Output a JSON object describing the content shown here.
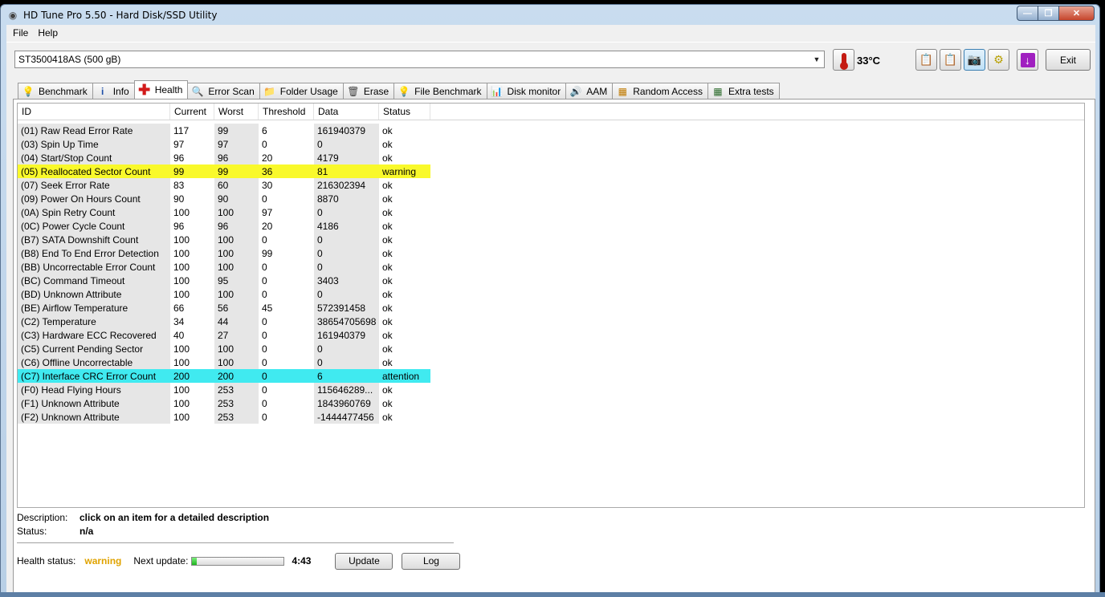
{
  "window": {
    "title": "HD Tune Pro 5.50 - Hard Disk/SSD Utility"
  },
  "menu": {
    "file": "File",
    "help": "Help"
  },
  "toolbar": {
    "drive": "ST3500418AS (500 gB)",
    "temperature": "33°C",
    "exit_label": "Exit"
  },
  "tabs": {
    "benchmark": "Benchmark",
    "info": "Info",
    "health": "Health",
    "error_scan": "Error Scan",
    "folder_usage": "Folder Usage",
    "erase": "Erase",
    "file_benchmark": "File Benchmark",
    "disk_monitor": "Disk monitor",
    "aam": "AAM",
    "random_access": "Random Access",
    "extra_tests": "Extra tests"
  },
  "grid": {
    "headers": [
      "ID",
      "Current",
      "Worst",
      "Threshold",
      "Data",
      "Status"
    ],
    "rows": [
      {
        "id": "(01) Raw Read Error Rate",
        "current": "117",
        "worst": "99",
        "threshold": "6",
        "data": "161940379",
        "status": "ok"
      },
      {
        "id": "(03) Spin Up Time",
        "current": "97",
        "worst": "97",
        "threshold": "0",
        "data": "0",
        "status": "ok"
      },
      {
        "id": "(04) Start/Stop Count",
        "current": "96",
        "worst": "96",
        "threshold": "20",
        "data": "4179",
        "status": "ok"
      },
      {
        "id": "(05) Reallocated Sector Count",
        "current": "99",
        "worst": "99",
        "threshold": "36",
        "data": "81",
        "status": "warning"
      },
      {
        "id": "(07) Seek Error Rate",
        "current": "83",
        "worst": "60",
        "threshold": "30",
        "data": "216302394",
        "status": "ok"
      },
      {
        "id": "(09) Power On Hours Count",
        "current": "90",
        "worst": "90",
        "threshold": "0",
        "data": "8870",
        "status": "ok"
      },
      {
        "id": "(0A) Spin Retry Count",
        "current": "100",
        "worst": "100",
        "threshold": "97",
        "data": "0",
        "status": "ok"
      },
      {
        "id": "(0C) Power Cycle Count",
        "current": "96",
        "worst": "96",
        "threshold": "20",
        "data": "4186",
        "status": "ok"
      },
      {
        "id": "(B7) SATA Downshift Count",
        "current": "100",
        "worst": "100",
        "threshold": "0",
        "data": "0",
        "status": "ok"
      },
      {
        "id": "(B8) End To End Error Detection",
        "current": "100",
        "worst": "100",
        "threshold": "99",
        "data": "0",
        "status": "ok"
      },
      {
        "id": "(BB) Uncorrectable Error Count",
        "current": "100",
        "worst": "100",
        "threshold": "0",
        "data": "0",
        "status": "ok"
      },
      {
        "id": "(BC) Command Timeout",
        "current": "100",
        "worst": "95",
        "threshold": "0",
        "data": "3403",
        "status": "ok"
      },
      {
        "id": "(BD) Unknown Attribute",
        "current": "100",
        "worst": "100",
        "threshold": "0",
        "data": "0",
        "status": "ok"
      },
      {
        "id": "(BE) Airflow Temperature",
        "current": "66",
        "worst": "56",
        "threshold": "45",
        "data": "572391458",
        "status": "ok"
      },
      {
        "id": "(C2) Temperature",
        "current": "34",
        "worst": "44",
        "threshold": "0",
        "data": "38654705698",
        "status": "ok"
      },
      {
        "id": "(C3) Hardware ECC Recovered",
        "current": "40",
        "worst": "27",
        "threshold": "0",
        "data": "161940379",
        "status": "ok"
      },
      {
        "id": "(C5) Current Pending Sector",
        "current": "100",
        "worst": "100",
        "threshold": "0",
        "data": "0",
        "status": "ok"
      },
      {
        "id": "(C6) Offline Uncorrectable",
        "current": "100",
        "worst": "100",
        "threshold": "0",
        "data": "0",
        "status": "ok"
      },
      {
        "id": "(C7) Interface CRC Error Count",
        "current": "200",
        "worst": "200",
        "threshold": "0",
        "data": "6",
        "status": "attention"
      },
      {
        "id": "(F0) Head Flying Hours",
        "current": "100",
        "worst": "253",
        "threshold": "0",
        "data": "115646289...",
        "status": "ok"
      },
      {
        "id": "(F1) Unknown Attribute",
        "current": "100",
        "worst": "253",
        "threshold": "0",
        "data": "1843960769",
        "status": "ok"
      },
      {
        "id": "(F2) Unknown Attribute",
        "current": "100",
        "worst": "253",
        "threshold": "0",
        "data": "-1444477456",
        "status": "ok"
      }
    ]
  },
  "description": {
    "label": "Description:",
    "value": "click on an item for a detailed description",
    "status_label": "Status:",
    "status_value": "n/a"
  },
  "health": {
    "label": "Health status:",
    "value": "warning",
    "next_update_label": "Next update:",
    "progress": 0.05,
    "timer": "4:43",
    "update_label": "Update",
    "log_label": "Log"
  },
  "colors": {
    "warning_row": "#f9f92b",
    "attention_row": "#40eaf0",
    "health_warning_text": "#e0a300"
  }
}
